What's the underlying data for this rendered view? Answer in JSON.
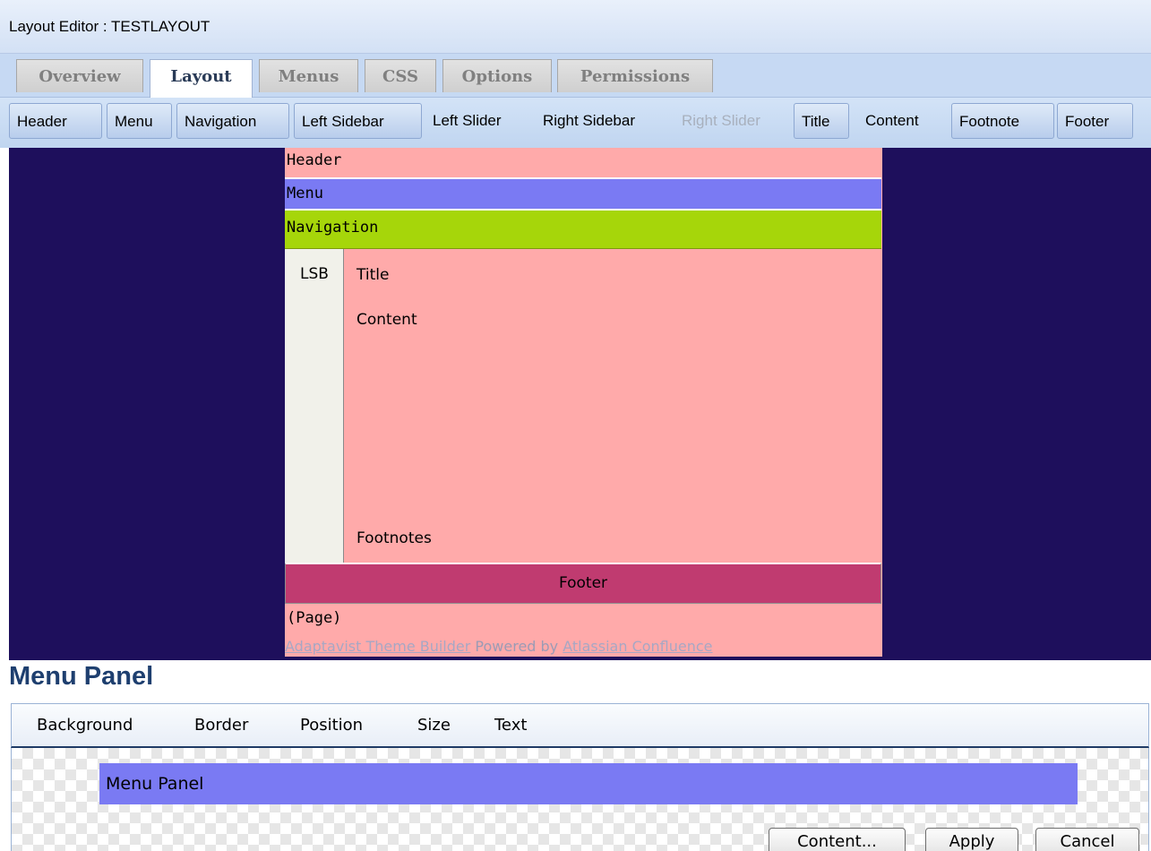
{
  "window": {
    "title": "Layout Editor : TESTLAYOUT"
  },
  "tabs": [
    {
      "label": "Overview",
      "active": false
    },
    {
      "label": "Layout",
      "active": true
    },
    {
      "label": "Menus",
      "active": false
    },
    {
      "label": "CSS",
      "active": false
    },
    {
      "label": "Options",
      "active": false
    },
    {
      "label": "Permissions",
      "active": false
    }
  ],
  "subtabs": [
    {
      "label": "Header",
      "state": "boxed"
    },
    {
      "label": "Menu",
      "state": "boxed"
    },
    {
      "label": "Navigation",
      "state": "boxed"
    },
    {
      "label": "Left Sidebar",
      "state": "boxed"
    },
    {
      "label": "Left Slider",
      "state": "plain"
    },
    {
      "label": "Right Sidebar",
      "state": "plain"
    },
    {
      "label": "Right Slider",
      "state": "disabled"
    },
    {
      "label": "Title",
      "state": "boxed"
    },
    {
      "label": "Content",
      "state": "plain"
    },
    {
      "label": "Footnote",
      "state": "boxed"
    },
    {
      "label": "Footer",
      "state": "boxed"
    }
  ],
  "preview": {
    "header": "Header",
    "menu": "Menu",
    "navigation": "Navigation",
    "lsb": "LSB",
    "title": "Title",
    "content": "Content",
    "footnotes": "Footnotes",
    "footer": "Footer",
    "page": "(Page)",
    "credit": {
      "link1": "Adaptavist Theme Builder",
      "middle": " Powered by ",
      "link2": "Atlassian Confluence"
    }
  },
  "panel": {
    "heading": "Menu Panel",
    "tabs": [
      "Background",
      "Border",
      "Position",
      "Size",
      "Text"
    ],
    "preview_label": "Menu Panel",
    "buttons": {
      "content": "Content...",
      "apply": "Apply",
      "cancel": "Cancel"
    }
  },
  "colors": {
    "canvas": "#1e0f5c",
    "page": "#ffaaaa",
    "menu": "#7a7af3",
    "navigation": "#a6d60a",
    "footer": "#c03b70",
    "sidebar": "#f1f1ea"
  }
}
